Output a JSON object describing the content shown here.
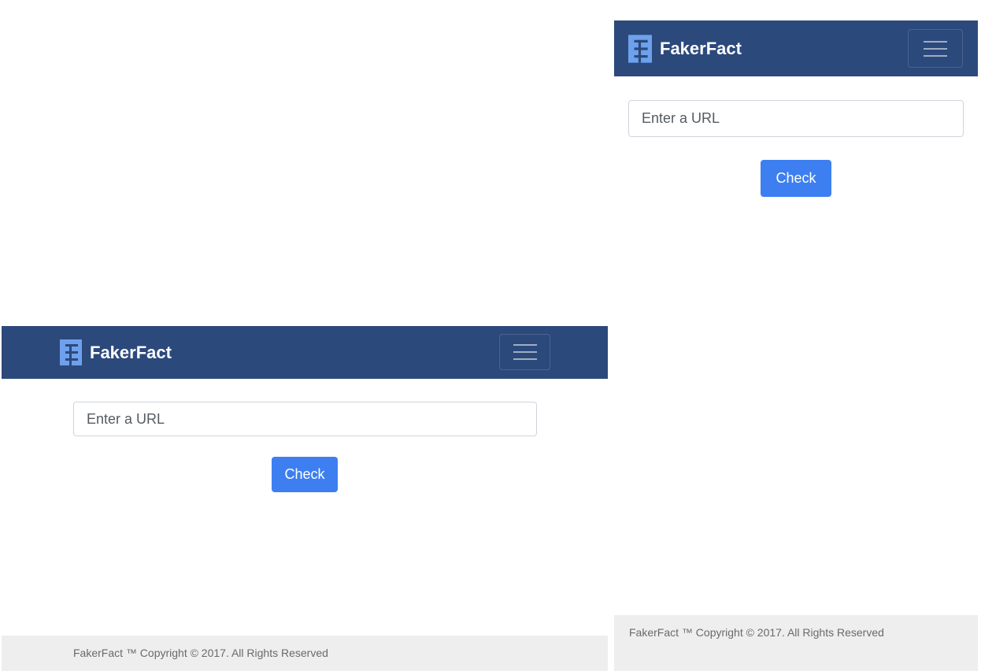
{
  "brand": {
    "name": "FakerFact"
  },
  "search": {
    "placeholder": "Enter a URL"
  },
  "actions": {
    "check_label": "Check"
  },
  "footer": {
    "text": "FakerFact ™  Copyright © 2017. All Rights Reserved"
  },
  "colors": {
    "navbar": "#2c497c",
    "logo": "#6ea1ec",
    "button": "#3d7ff0",
    "footer_bg": "#eeeeee",
    "footer_text": "#6a6a6a"
  },
  "icons": {
    "logo": "fakerfact-logo-icon",
    "menu": "hamburger-menu-icon"
  }
}
